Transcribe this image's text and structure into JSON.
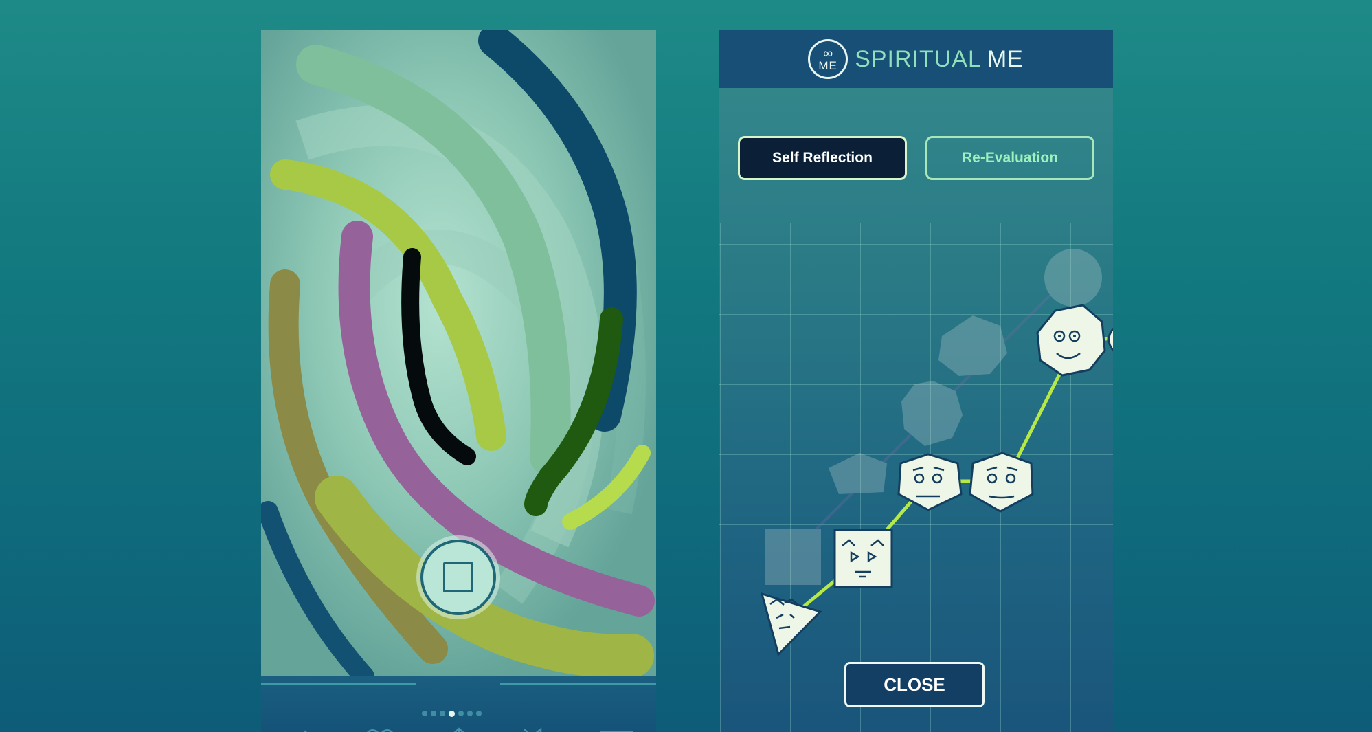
{
  "left_phone": {
    "page_dots": {
      "count": 7,
      "active_index": 3
    },
    "toolbar": [
      {
        "icon": "back-arrow-icon"
      },
      {
        "icon": "heart-icon"
      },
      {
        "icon": "share-icon"
      },
      {
        "icon": "mute-icon"
      },
      {
        "icon": "menu-icon"
      }
    ],
    "stop_button": {
      "icon": "stop-icon"
    }
  },
  "right_phone": {
    "header": {
      "title_part1": "SPIRITUAL",
      "title_part2": "ME",
      "logo_text": "ME",
      "logo_symbol": "∞"
    },
    "tabs": {
      "self_reflection": "Self Reflection",
      "re_evaluation": "Re-Evaluation"
    },
    "close_label": "CLOSE"
  },
  "colors": {
    "accent_green": "#b6e84a",
    "header_bg": "#174f76",
    "button_dark": "#0b2036",
    "tab_outline": "#a8e8b8"
  }
}
